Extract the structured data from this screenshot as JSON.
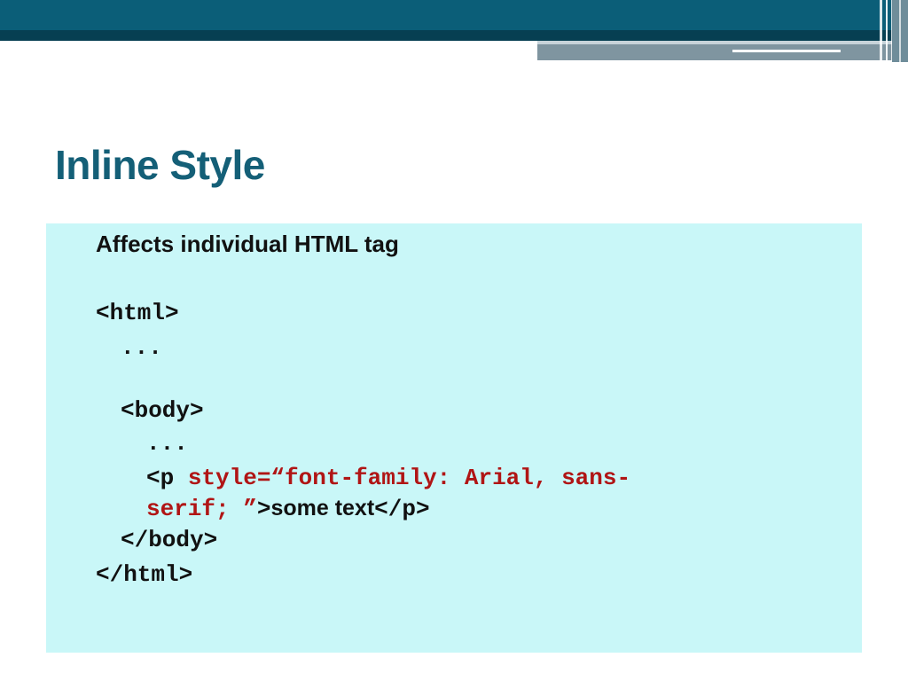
{
  "slide": {
    "title": "Inline Style",
    "intro": "Affects individual HTML tag",
    "code": {
      "html_open": "<html>",
      "dots_1": "...",
      "body_open": "<body>",
      "dots_2": "...",
      "p_tag_open": "<p ",
      "style_attr_line1": "style=“font-family: Arial, sans-",
      "style_attr_line2": "serif; ”",
      "p_close_bracket": ">",
      "p_text": "some text",
      "p_close_tag": "</p>",
      "body_close": "</body>",
      "html_close": "</html>"
    }
  },
  "colors": {
    "title": "#145f77",
    "header_bar": "#0b5e78",
    "content_background": "#c9f7f8",
    "code_attribute": "#b01515"
  }
}
